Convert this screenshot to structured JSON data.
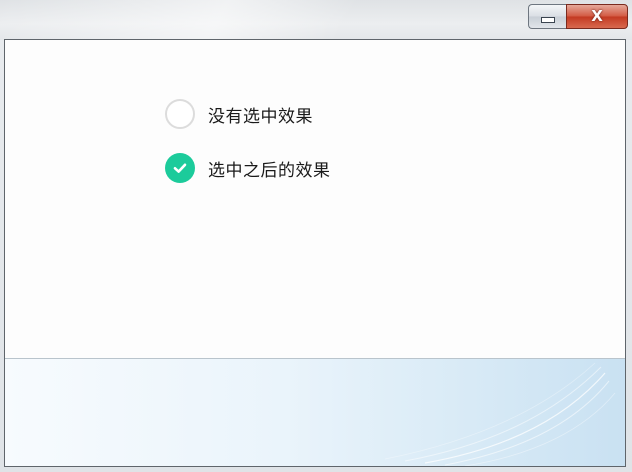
{
  "window": {
    "minimize_symbol": "–",
    "close_symbol": "X"
  },
  "options": [
    {
      "label": "没有选中效果",
      "checked": false,
      "icon": "unchecked-circle-icon"
    },
    {
      "label": "选中之后的效果",
      "checked": true,
      "icon": "checkmark-circle-icon"
    }
  ],
  "colors": {
    "accent": "#1ccb9b",
    "unchecked_border": "#dcdcdc",
    "close_button": "#c8432b"
  }
}
